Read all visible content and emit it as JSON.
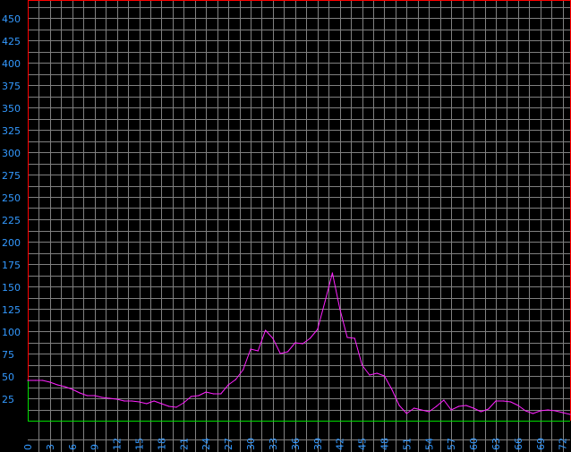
{
  "chart_data": {
    "type": "line",
    "title": "",
    "xlabel": "",
    "ylabel": "",
    "xlim": [
      0,
      73
    ],
    "ylim": [
      0,
      470
    ],
    "grid": true,
    "x_ticks": [
      "0",
      "3",
      "6",
      "9",
      "12",
      "15",
      "18",
      "21",
      "24",
      "27",
      "30",
      "33",
      "36",
      "39",
      "42",
      "45",
      "48",
      "51",
      "54",
      "57",
      "60",
      "63",
      "66",
      "69",
      "72"
    ],
    "y_ticks": [
      "25",
      "50",
      "75",
      "100",
      "125",
      "150",
      "175",
      "200",
      "225",
      "250",
      "275",
      "300",
      "325",
      "350",
      "375",
      "400",
      "425",
      "450"
    ],
    "series": [
      {
        "name": "",
        "x": [
          0,
          1,
          2,
          3,
          4,
          5,
          6,
          7,
          8,
          9,
          10,
          11,
          12,
          13,
          14,
          15,
          16,
          17,
          18,
          19,
          20,
          21,
          22,
          23,
          24,
          25,
          26,
          27,
          28,
          29,
          30,
          31,
          32,
          33,
          34,
          35,
          36,
          37,
          38,
          39,
          40,
          41,
          42,
          43,
          44,
          45,
          46,
          47,
          48,
          49,
          50,
          51,
          52,
          53,
          54,
          55,
          56,
          57,
          58,
          59,
          60,
          61,
          62,
          63,
          64,
          65,
          66,
          67,
          68,
          69,
          70,
          71,
          72,
          73
        ],
        "values": [
          45,
          45,
          45,
          43,
          40,
          38,
          35,
          31,
          28,
          28,
          26,
          25,
          24,
          22,
          22,
          21,
          19,
          22,
          19,
          16,
          15,
          20,
          27,
          28,
          32,
          30,
          30,
          40,
          46,
          57,
          80,
          78,
          101,
          92,
          75,
          77,
          87,
          86,
          92,
          102,
          133,
          165,
          125,
          93,
          92,
          62,
          51,
          53,
          50,
          35,
          17,
          8,
          14,
          12,
          10,
          16,
          23,
          12,
          16,
          17,
          14,
          10,
          13,
          22,
          22,
          21,
          17,
          11,
          8,
          11,
          12,
          11,
          9,
          7
        ]
      }
    ],
    "colors": {
      "background": "#000000",
      "grid": "#808080",
      "line": "#ff22ff",
      "baseline": "#00dd00",
      "border": "#ff0000",
      "tick_label": "#3399ff"
    }
  }
}
